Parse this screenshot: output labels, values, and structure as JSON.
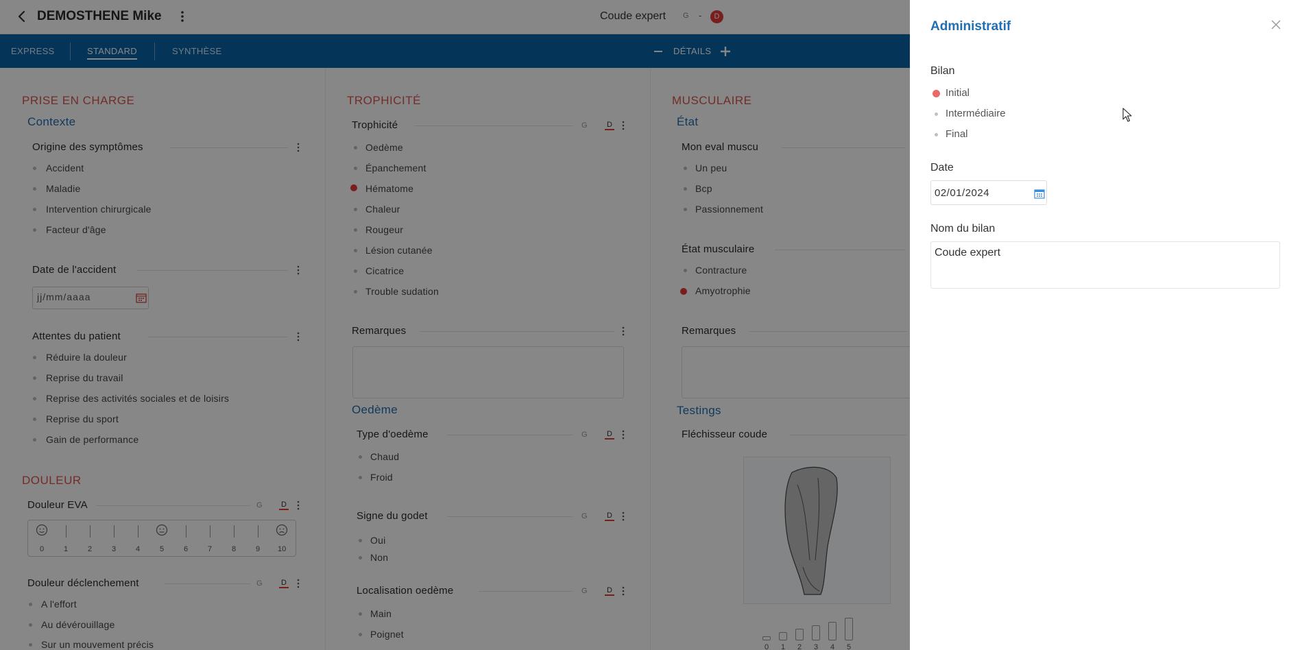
{
  "header": {
    "patient_name": "DEMOSTHENE Mike",
    "bilan_name": "Coude expert",
    "side_g": "G",
    "side_sep": "-",
    "side_d": "D"
  },
  "navbar": {
    "tabs": [
      {
        "label": "EXPRESS"
      },
      {
        "label": "STANDARD"
      },
      {
        "label": "SYNTHÈSE"
      }
    ],
    "details_label": "DÉTAILS"
  },
  "col1": {
    "section": "PRISE EN CHARGE",
    "contexte": "Contexte",
    "origine": {
      "title": "Origine des symptômes",
      "options": [
        "Accident",
        "Maladie",
        "Intervention chirurgicale",
        "Facteur d'âge"
      ]
    },
    "date_accident": {
      "title": "Date de l'accident",
      "placeholder": "jj/mm/aaaa"
    },
    "attentes": {
      "title": "Attentes du patient",
      "options": [
        "Réduire la douleur",
        "Reprise du travail",
        "Reprise des activités sociales et de loisirs",
        "Reprise du sport",
        "Gain de performance"
      ]
    },
    "douleur_section": "DOULEUR",
    "douleur_eva": {
      "title": "Douleur EVA",
      "g": "G",
      "d": "D",
      "scale": [
        "0",
        "1",
        "2",
        "3",
        "4",
        "5",
        "6",
        "7",
        "8",
        "9",
        "10"
      ]
    },
    "douleur_declenchement": {
      "title": "Douleur déclenchement",
      "g": "G",
      "d": "D",
      "options": [
        "A l'effort",
        "Au dévérouillage",
        "Sur un mouvement précis"
      ]
    }
  },
  "col2": {
    "section": "TROPHICITÉ",
    "trophicite": {
      "title": "Trophicité",
      "g": "G",
      "d": "D",
      "options": [
        "Oedème",
        "Épanchement",
        "Hématome",
        "Chaleur",
        "Rougeur",
        "Lésion cutanée",
        "Cicatrice",
        "Trouble sudation"
      ],
      "selected": "Hématome"
    },
    "remarques": "Remarques",
    "oedeme_title": "Oedème",
    "type_oedeme": {
      "title": "Type d'oedème",
      "g": "G",
      "d": "D",
      "options": [
        "Chaud",
        "Froid"
      ]
    },
    "signe_godet": {
      "title": "Signe du godet",
      "g": "G",
      "d": "D",
      "options": [
        "Oui",
        "Non"
      ]
    },
    "localisation": {
      "title": "Localisation oedème",
      "g": "G",
      "d": "D",
      "options": [
        "Main",
        "Poignet"
      ]
    }
  },
  "col3": {
    "section": "MUSCULAIRE",
    "etat": "État",
    "mon_eval": {
      "title": "Mon eval muscu",
      "options": [
        "Un peu",
        "Bcp",
        "Passionnement"
      ]
    },
    "etat_musculaire": {
      "title": "État musculaire",
      "options": [
        "Contracture",
        "Amyotrophie"
      ],
      "selected": "Amyotrophie"
    },
    "remarques": "Remarques",
    "testings": "Testings",
    "flechisseur": "Fléchisseur coude",
    "scale": [
      "0",
      "1",
      "2",
      "3",
      "4",
      "5"
    ]
  },
  "drawer": {
    "title": "Administratif",
    "bilan_label": "Bilan",
    "bilan_options": [
      "Initial",
      "Intermédiaire",
      "Final"
    ],
    "bilan_selected": "Initial",
    "date_label": "Date",
    "date_value": "02/01/2024",
    "nom_label": "Nom du bilan",
    "nom_value": "Coude expert"
  },
  "colors": {
    "primary": "#0a63a8",
    "accent_red": "#e53935",
    "title_blue": "#1f6fb2",
    "section_red": "#d9534f"
  },
  "icons": [
    "back-arrow-icon",
    "kebab-menu-icon",
    "minus-icon",
    "plus-icon",
    "calendar-icon",
    "close-icon",
    "smiley-icon",
    "mouse-cursor-icon"
  ]
}
